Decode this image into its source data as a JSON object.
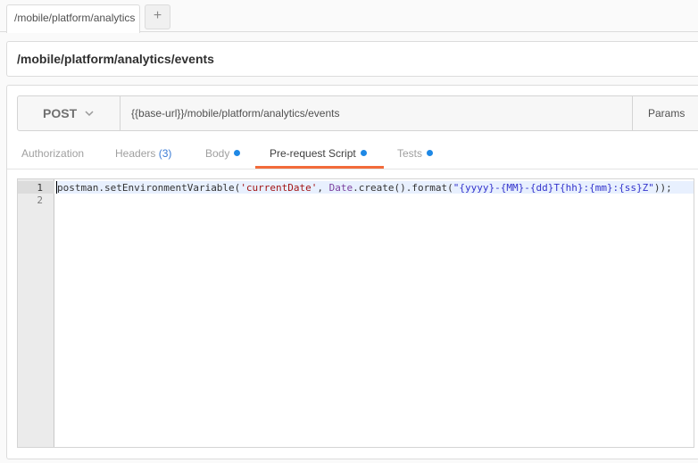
{
  "tabbar": {
    "request_tab_label": "/mobile/platform/analytics",
    "new_tab_label": "+"
  },
  "request": {
    "name": "/mobile/platform/analytics/events",
    "method": "POST",
    "url": "{{base-url}}/mobile/platform/analytics/events",
    "params_label": "Params"
  },
  "tabs": [
    {
      "label": "Authorization",
      "count": "",
      "has_dot": false
    },
    {
      "label": "Headers",
      "count": "(3)",
      "has_dot": false
    },
    {
      "label": "Body",
      "count": "",
      "has_dot": true
    },
    {
      "label": "Pre-request Script",
      "count": "",
      "has_dot": true,
      "active": true
    },
    {
      "label": "Tests",
      "count": "",
      "has_dot": true
    }
  ],
  "editor": {
    "line_numbers": [
      "1",
      "2"
    ],
    "code": {
      "obj": "postman",
      "method1": ".setEnvironmentVariable(",
      "arg1": "'currentDate'",
      "sep": ", ",
      "cls": "Date",
      "method2": ".create().format(",
      "arg2": "\"{yyyy}-{MM}-{dd}T{hh}:{mm}:{ss}Z\"",
      "end": "));"
    }
  },
  "colors": {
    "accent": "#f26b3a",
    "dot": "#1e88e5",
    "count": "#3a7bd5"
  }
}
